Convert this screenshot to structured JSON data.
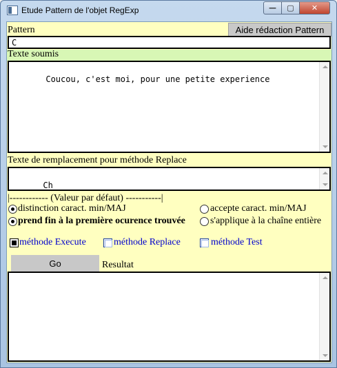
{
  "window": {
    "title": "Etude Pattern de l'objet RegExp",
    "minimize": "—",
    "maximize": "▢",
    "close": "✕"
  },
  "pattern": {
    "label": "Pattern",
    "help_button": "Aide rédaction Pattern",
    "value": "C"
  },
  "submitted": {
    "label": "Texte soumis",
    "value": "Coucou, c'est moi, pour une petite experience"
  },
  "replace": {
    "label": "Texte de remplacement pour méthode Replace",
    "value": "Ch"
  },
  "options": {
    "header": "|------------ (Valeur par défaut) -----------|",
    "case_sensitive": "distinction caract. min/MAJ",
    "case_insensitive": "accepte caract. min/MAJ",
    "first_match": "prend fin à la première ocurence trouvée",
    "global": "s'applique à la chaîne entière"
  },
  "methods": {
    "execute": "méthode Execute",
    "replace": "méthode Replace",
    "test": "méthode Test",
    "selected": "execute"
  },
  "actions": {
    "go": "Go",
    "result_label": "Resultat",
    "result_value": ""
  },
  "colors": {
    "background": "#ffffc0",
    "label_band": "#d8f7b5",
    "method_text": "#0000cc"
  }
}
